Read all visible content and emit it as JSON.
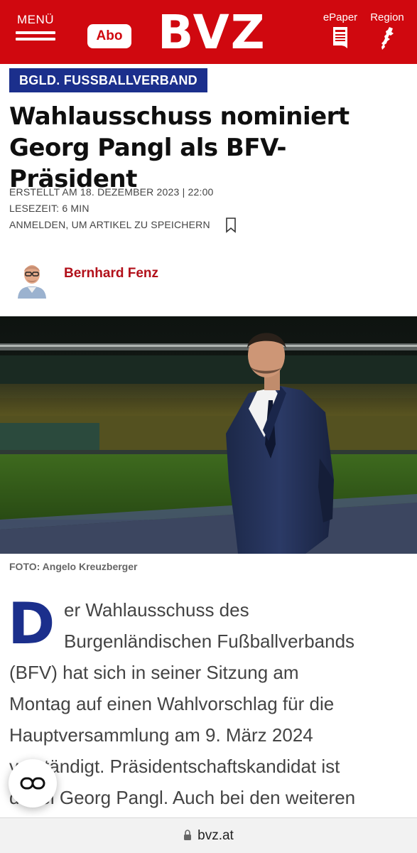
{
  "header": {
    "menu_label": "MENÜ",
    "abo_label": "Abo",
    "logo": "BVZ",
    "epaper_label": "ePaper",
    "region_label": "Region",
    "brand_color": "#d0080f"
  },
  "article": {
    "category": "BGLD. FUSSBALLVERBAND",
    "title_line1": "Wahlausschuss nominiert",
    "title_line2": "Georg Pangl als BFV-Präsident",
    "created": "ERSTELLT AM 18. DEZEMBER 2023 | 22:00",
    "reading_time": "LESEZEIT: 6 MIN",
    "save_prompt": "ANMELDEN, UM ARTIKEL ZU SPEICHERN",
    "author": "Bernhard Fenz",
    "photo_credit": "FOTO: Angelo Kreuzberger",
    "dropcap": "D",
    "body_lines": [
      "er Wahlausschuss des",
      "Burgenländischen Fußballverbands",
      "(BFV) hat sich in seiner Sitzung am",
      "Montag auf einen Wahlvorschlag für die",
      "Hauptversammlung am 9. März 2024",
      "verständigt. Präsidentschaftskandidat ist",
      "dabei Georg Pangl. Auch bei den weiteren"
    ]
  },
  "browser": {
    "url": "bvz.at"
  },
  "icons": {
    "menu": "hamburger-icon",
    "epaper": "newspaper-icon",
    "region": "map-region-icon",
    "save": "bookmark-icon",
    "reader": "reader-mode-icon",
    "url": "lock-icon"
  }
}
